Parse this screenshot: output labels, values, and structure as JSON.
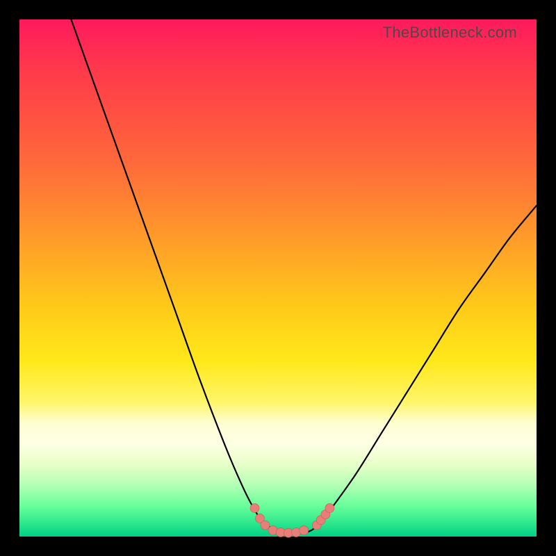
{
  "attribution": "TheBottleneck.com",
  "colors": {
    "page_background": "#000000",
    "gradient_stops": [
      "#ff1a5e",
      "#ff3a4a",
      "#ff6a3a",
      "#ff9a2a",
      "#ffc81a",
      "#ffe81a",
      "#fff56a",
      "#fdfed0",
      "#ffffe6",
      "#e8ffc8",
      "#b4ffb5",
      "#6aff9a",
      "#22e38a",
      "#00d084"
    ],
    "curve_color": "#000000",
    "marker_fill": "#e77f78",
    "marker_stroke": "#c65a54",
    "attribution_color": "#4a4a4a"
  },
  "chart_data": {
    "type": "line",
    "title": "",
    "xlabel": "",
    "ylabel": "",
    "xlim": [
      0,
      100
    ],
    "ylim": [
      0,
      100
    ],
    "grid": false,
    "legend": false,
    "series": [
      {
        "name": "bottleneck-curve",
        "x": [
          10,
          15,
          20,
          25,
          30,
          35,
          40,
          43,
          45,
          47,
          50,
          53,
          56,
          58,
          60,
          65,
          70,
          75,
          80,
          85,
          90,
          95,
          100
        ],
        "y": [
          100,
          86,
          72,
          58,
          44,
          30,
          17,
          10,
          6,
          3,
          1,
          0.6,
          1,
          2.5,
          5,
          12,
          20,
          28,
          36,
          44,
          51,
          58,
          64
        ]
      }
    ],
    "markers": [
      {
        "x": 45.5,
        "y": 5.5
      },
      {
        "x": 46.5,
        "y": 3.5
      },
      {
        "x": 47.5,
        "y": 2.2
      },
      {
        "x": 49.0,
        "y": 1.2
      },
      {
        "x": 50.5,
        "y": 0.8
      },
      {
        "x": 52.0,
        "y": 0.7
      },
      {
        "x": 53.5,
        "y": 0.8
      },
      {
        "x": 55.0,
        "y": 1.2
      },
      {
        "x": 57.5,
        "y": 2.2
      },
      {
        "x": 58.3,
        "y": 3.2
      },
      {
        "x": 59.2,
        "y": 4.3
      },
      {
        "x": 60.0,
        "y": 5.5
      }
    ]
  }
}
